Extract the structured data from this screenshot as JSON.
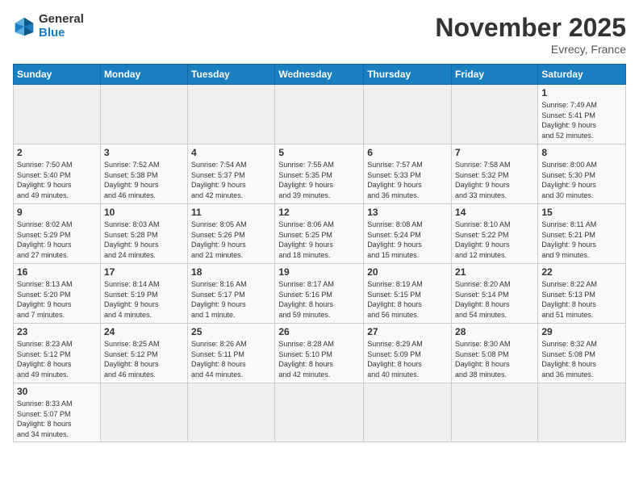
{
  "header": {
    "logo_general": "General",
    "logo_blue": "Blue",
    "month_title": "November 2025",
    "location": "Evrecy, France"
  },
  "weekdays": [
    "Sunday",
    "Monday",
    "Tuesday",
    "Wednesday",
    "Thursday",
    "Friday",
    "Saturday"
  ],
  "days": [
    {
      "date": "",
      "info": ""
    },
    {
      "date": "",
      "info": ""
    },
    {
      "date": "",
      "info": ""
    },
    {
      "date": "",
      "info": ""
    },
    {
      "date": "",
      "info": ""
    },
    {
      "date": "",
      "info": ""
    },
    {
      "date": "1",
      "info": "Sunrise: 7:49 AM\nSunset: 5:41 PM\nDaylight: 9 hours\nand 52 minutes."
    },
    {
      "date": "2",
      "info": "Sunrise: 7:50 AM\nSunset: 5:40 PM\nDaylight: 9 hours\nand 49 minutes."
    },
    {
      "date": "3",
      "info": "Sunrise: 7:52 AM\nSunset: 5:38 PM\nDaylight: 9 hours\nand 46 minutes."
    },
    {
      "date": "4",
      "info": "Sunrise: 7:54 AM\nSunset: 5:37 PM\nDaylight: 9 hours\nand 42 minutes."
    },
    {
      "date": "5",
      "info": "Sunrise: 7:55 AM\nSunset: 5:35 PM\nDaylight: 9 hours\nand 39 minutes."
    },
    {
      "date": "6",
      "info": "Sunrise: 7:57 AM\nSunset: 5:33 PM\nDaylight: 9 hours\nand 36 minutes."
    },
    {
      "date": "7",
      "info": "Sunrise: 7:58 AM\nSunset: 5:32 PM\nDaylight: 9 hours\nand 33 minutes."
    },
    {
      "date": "8",
      "info": "Sunrise: 8:00 AM\nSunset: 5:30 PM\nDaylight: 9 hours\nand 30 minutes."
    },
    {
      "date": "9",
      "info": "Sunrise: 8:02 AM\nSunset: 5:29 PM\nDaylight: 9 hours\nand 27 minutes."
    },
    {
      "date": "10",
      "info": "Sunrise: 8:03 AM\nSunset: 5:28 PM\nDaylight: 9 hours\nand 24 minutes."
    },
    {
      "date": "11",
      "info": "Sunrise: 8:05 AM\nSunset: 5:26 PM\nDaylight: 9 hours\nand 21 minutes."
    },
    {
      "date": "12",
      "info": "Sunrise: 8:06 AM\nSunset: 5:25 PM\nDaylight: 9 hours\nand 18 minutes."
    },
    {
      "date": "13",
      "info": "Sunrise: 8:08 AM\nSunset: 5:24 PM\nDaylight: 9 hours\nand 15 minutes."
    },
    {
      "date": "14",
      "info": "Sunrise: 8:10 AM\nSunset: 5:22 PM\nDaylight: 9 hours\nand 12 minutes."
    },
    {
      "date": "15",
      "info": "Sunrise: 8:11 AM\nSunset: 5:21 PM\nDaylight: 9 hours\nand 9 minutes."
    },
    {
      "date": "16",
      "info": "Sunrise: 8:13 AM\nSunset: 5:20 PM\nDaylight: 9 hours\nand 7 minutes."
    },
    {
      "date": "17",
      "info": "Sunrise: 8:14 AM\nSunset: 5:19 PM\nDaylight: 9 hours\nand 4 minutes."
    },
    {
      "date": "18",
      "info": "Sunrise: 8:16 AM\nSunset: 5:17 PM\nDaylight: 9 hours\nand 1 minute."
    },
    {
      "date": "19",
      "info": "Sunrise: 8:17 AM\nSunset: 5:16 PM\nDaylight: 8 hours\nand 59 minutes."
    },
    {
      "date": "20",
      "info": "Sunrise: 8:19 AM\nSunset: 5:15 PM\nDaylight: 8 hours\nand 56 minutes."
    },
    {
      "date": "21",
      "info": "Sunrise: 8:20 AM\nSunset: 5:14 PM\nDaylight: 8 hours\nand 54 minutes."
    },
    {
      "date": "22",
      "info": "Sunrise: 8:22 AM\nSunset: 5:13 PM\nDaylight: 8 hours\nand 51 minutes."
    },
    {
      "date": "23",
      "info": "Sunrise: 8:23 AM\nSunset: 5:12 PM\nDaylight: 8 hours\nand 49 minutes."
    },
    {
      "date": "24",
      "info": "Sunrise: 8:25 AM\nSunset: 5:12 PM\nDaylight: 8 hours\nand 46 minutes."
    },
    {
      "date": "25",
      "info": "Sunrise: 8:26 AM\nSunset: 5:11 PM\nDaylight: 8 hours\nand 44 minutes."
    },
    {
      "date": "26",
      "info": "Sunrise: 8:28 AM\nSunset: 5:10 PM\nDaylight: 8 hours\nand 42 minutes."
    },
    {
      "date": "27",
      "info": "Sunrise: 8:29 AM\nSunset: 5:09 PM\nDaylight: 8 hours\nand 40 minutes."
    },
    {
      "date": "28",
      "info": "Sunrise: 8:30 AM\nSunset: 5:08 PM\nDaylight: 8 hours\nand 38 minutes."
    },
    {
      "date": "29",
      "info": "Sunrise: 8:32 AM\nSunset: 5:08 PM\nDaylight: 8 hours\nand 36 minutes."
    },
    {
      "date": "30",
      "info": "Sunrise: 8:33 AM\nSunset: 5:07 PM\nDaylight: 8 hours\nand 34 minutes."
    },
    {
      "date": "",
      "info": ""
    },
    {
      "date": "",
      "info": ""
    },
    {
      "date": "",
      "info": ""
    },
    {
      "date": "",
      "info": ""
    },
    {
      "date": "",
      "info": ""
    },
    {
      "date": "",
      "info": ""
    }
  ]
}
